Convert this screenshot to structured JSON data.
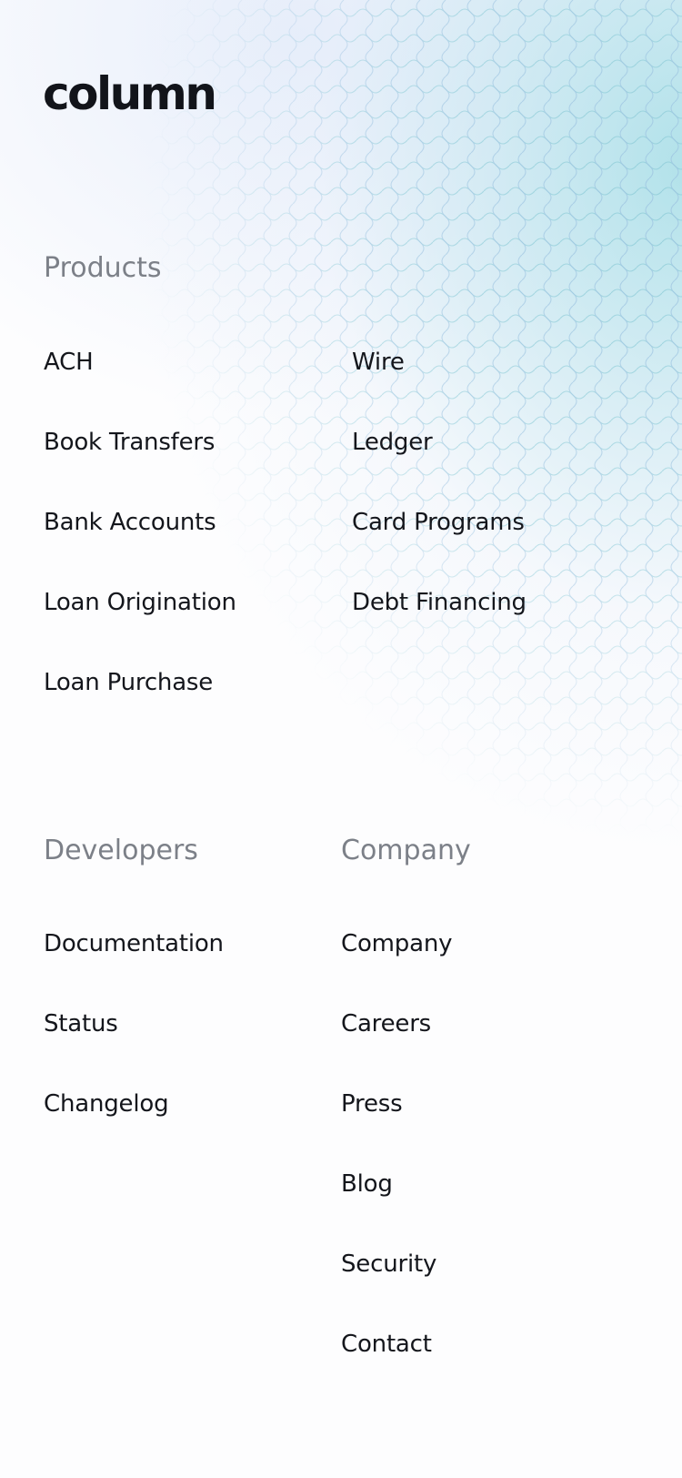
{
  "logo": {
    "text": "column"
  },
  "products": {
    "heading": "Products",
    "left_items": [
      "ACH",
      "Book Transfers",
      "Bank Accounts",
      "Loan Origination",
      "Loan Purchase"
    ],
    "right_items": [
      "Wire",
      "Ledger",
      "Card Programs",
      "Debt Financing"
    ]
  },
  "developers": {
    "heading": "Developers",
    "items": [
      "Documentation",
      "Status",
      "Changelog"
    ]
  },
  "company": {
    "heading": "Company",
    "items": [
      "Company",
      "Careers",
      "Press",
      "Blog",
      "Security",
      "Contact"
    ]
  },
  "colors": {
    "text": "#14161c",
    "heading": "#7c8088",
    "accent_glow": "#a4dde6",
    "background": "#fdfdfe"
  }
}
